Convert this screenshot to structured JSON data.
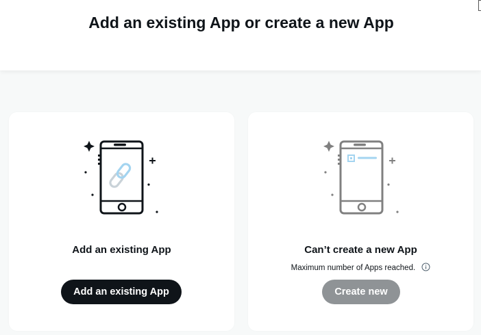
{
  "header": {
    "title": "Add an existing App or create a new App"
  },
  "cards": {
    "existing": {
      "title": "Add an existing App",
      "button_label": "Add an existing App",
      "illustration_icon": "phone-link-icon"
    },
    "create": {
      "title": "Can’t create a new App",
      "subtitle": "Maximum number of Apps reached.",
      "button_label": "Create new",
      "button_disabled": true,
      "illustration_icon": "phone-app-icon"
    }
  },
  "colors": {
    "page_background": "#f7f9f9",
    "card_background": "#ffffff",
    "primary_button": "#0f1419",
    "disabled_button": "#8f9396",
    "link_accent": "#a3d4f0",
    "muted_phone": "#808080"
  }
}
